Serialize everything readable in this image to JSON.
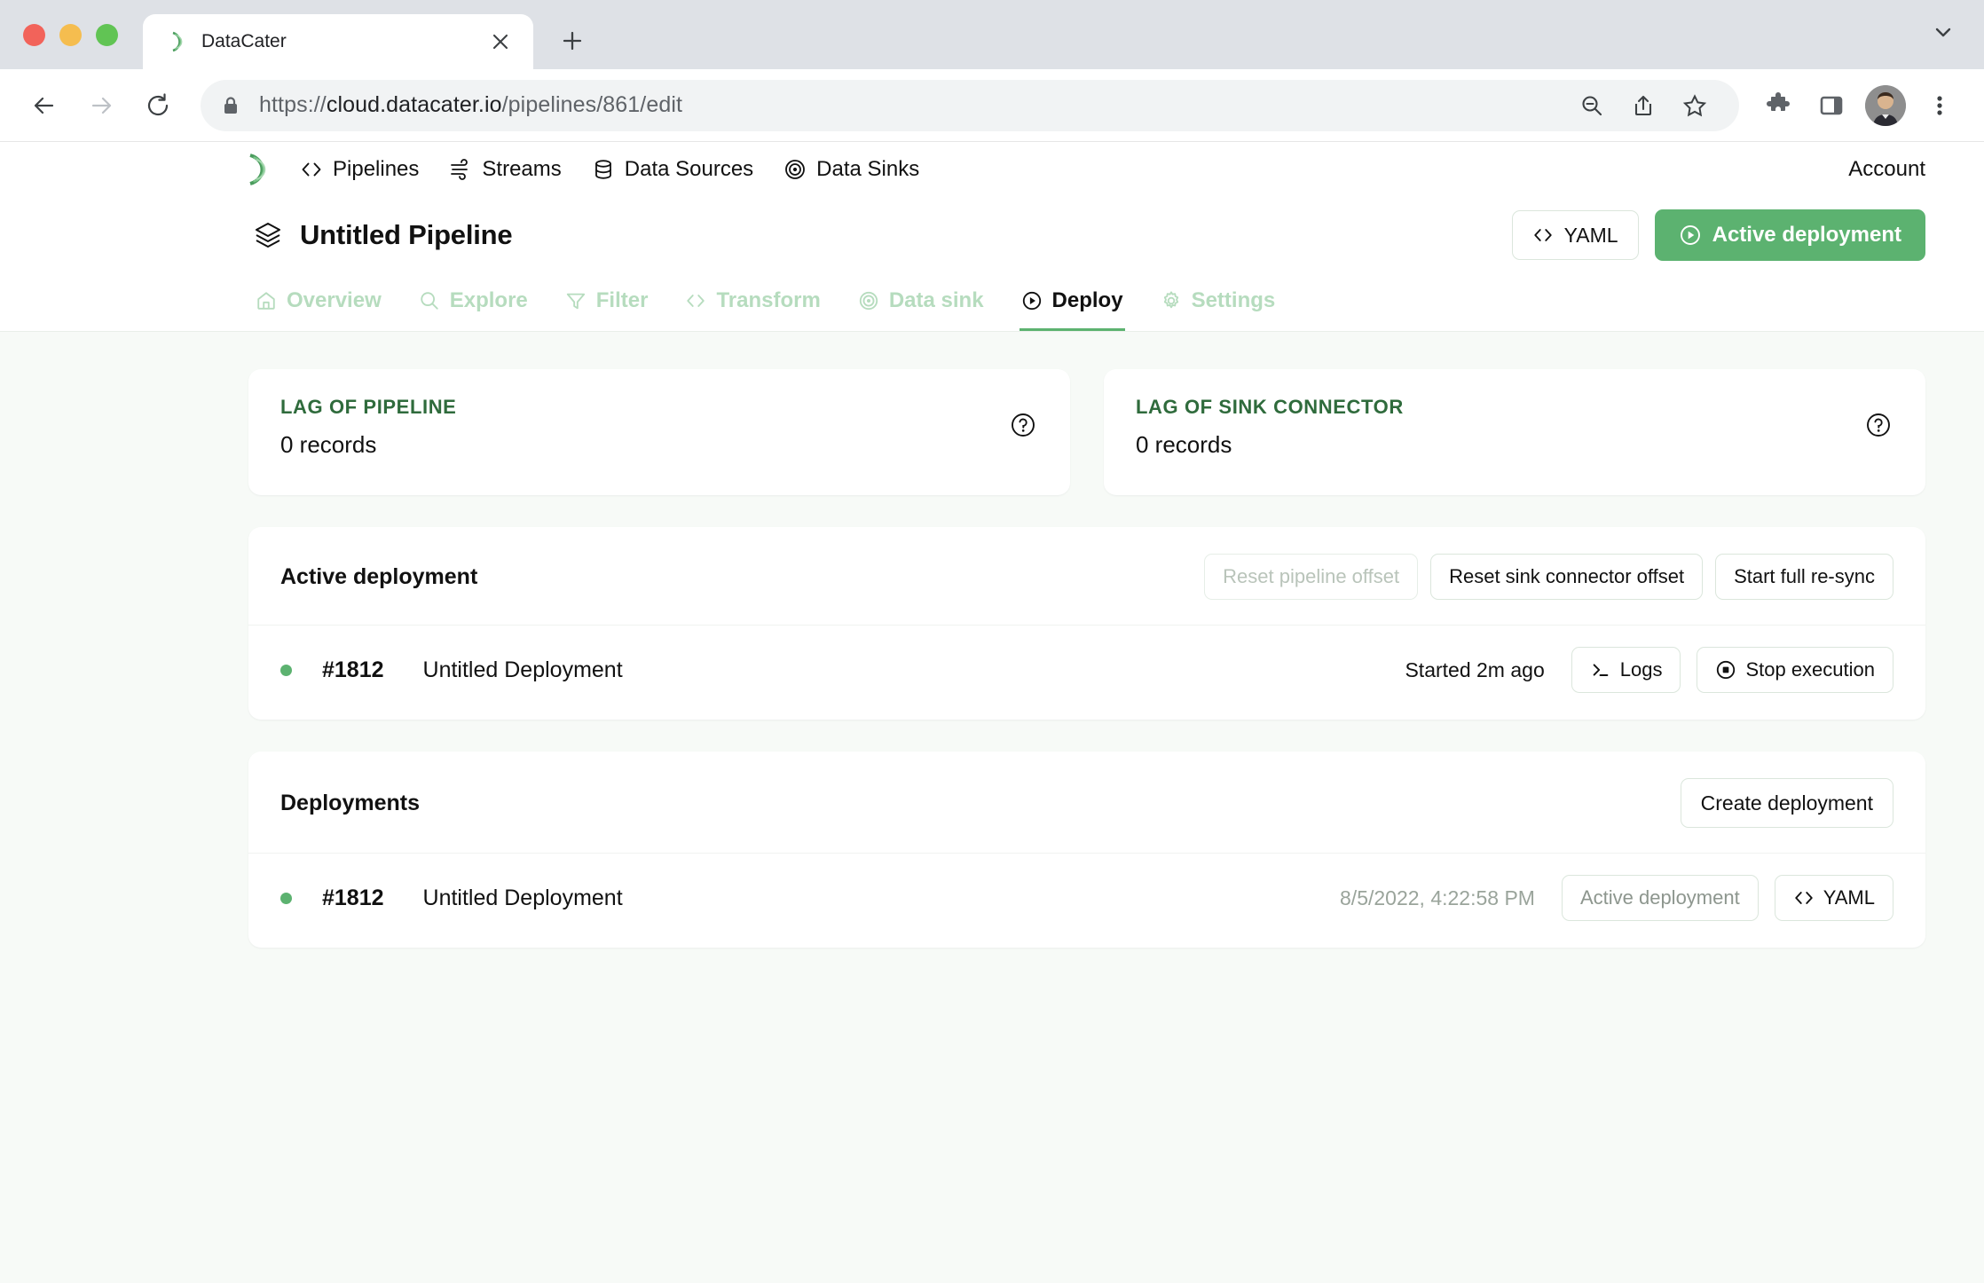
{
  "browser": {
    "tab": {
      "title": "DataCater",
      "favicon_icon": "datacater-logo-icon",
      "close_icon": "close-icon"
    },
    "newtab_icon": "plus-icon",
    "tablist_chevron_icon": "chevron-down-icon",
    "back_icon": "arrow-left-icon",
    "forward_icon": "arrow-right-icon",
    "reload_icon": "reload-icon",
    "lock_icon": "lock-icon",
    "url_scheme": "https://",
    "url_domain": "cloud.datacater.io",
    "url_path": "/pipelines/861/edit",
    "url_full": "https://cloud.datacater.io/pipelines/861/edit",
    "zoom_out_icon": "zoom-out-icon",
    "share_icon": "share-icon",
    "bookmark_icon": "star-icon",
    "extensions_icon": "puzzle-icon",
    "sidepanel_icon": "side-panel-icon",
    "profile_icon": "avatar",
    "menu_icon": "three-dots-vertical-icon"
  },
  "appnav": {
    "logo_icon": "datacater-logo-icon",
    "items": [
      {
        "label": "Pipelines",
        "icon": "code-brackets-icon",
        "active": true
      },
      {
        "label": "Streams",
        "icon": "streams-icon",
        "active": false
      },
      {
        "label": "Data Sources",
        "icon": "database-icon",
        "active": false
      },
      {
        "label": "Data Sinks",
        "icon": "target-icon",
        "active": false
      }
    ],
    "account_label": "Account"
  },
  "page": {
    "title": "Untitled Pipeline",
    "title_icon": "layers-icon",
    "yaml_button": {
      "label": "YAML",
      "icon": "code-brackets-icon"
    },
    "deployment_button": {
      "label": "Active deployment",
      "icon": "play-circle-icon"
    }
  },
  "tabs": [
    {
      "label": "Overview",
      "icon": "home-icon",
      "active": false
    },
    {
      "label": "Explore",
      "icon": "search-icon",
      "active": false
    },
    {
      "label": "Filter",
      "icon": "funnel-icon",
      "active": false
    },
    {
      "label": "Transform",
      "icon": "code-brackets-icon",
      "active": false
    },
    {
      "label": "Data sink",
      "icon": "target-icon",
      "active": false
    },
    {
      "label": "Deploy",
      "icon": "play-circle-icon",
      "active": true
    },
    {
      "label": "Settings",
      "icon": "gear-icon",
      "active": false
    }
  ],
  "stats": [
    {
      "label": "LAG OF PIPELINE",
      "value": "0 records",
      "help_icon": "question-circle-icon"
    },
    {
      "label": "LAG OF SINK CONNECTOR",
      "value": "0 records",
      "help_icon": "question-circle-icon"
    }
  ],
  "active_deployment": {
    "title": "Active deployment",
    "actions": [
      {
        "label": "Reset pipeline offset",
        "disabled": true
      },
      {
        "label": "Reset sink connector offset",
        "disabled": false
      },
      {
        "label": "Start full re-sync",
        "disabled": false
      }
    ],
    "row": {
      "id": "#1812",
      "name": "Untitled Deployment",
      "status": "running",
      "started": "Started 2m ago",
      "logs_button": {
        "label": "Logs",
        "icon": "terminal-icon"
      },
      "stop_button": {
        "label": "Stop execution",
        "icon": "stop-circle-icon"
      }
    }
  },
  "deployments": {
    "title": "Deployments",
    "create_button": {
      "label": "Create deployment"
    },
    "rows": [
      {
        "id": "#1812",
        "name": "Untitled Deployment",
        "status": "running",
        "timestamp": "8/5/2022, 4:22:58 PM",
        "badge": "Active deployment",
        "yaml_button": {
          "label": "YAML",
          "icon": "code-brackets-icon"
        }
      }
    ]
  },
  "colors": {
    "brand_green": "#5cb270",
    "dark_green": "#2f6b3c",
    "muted_green": "#b6dcbe",
    "page_bg": "#f7faf7"
  }
}
